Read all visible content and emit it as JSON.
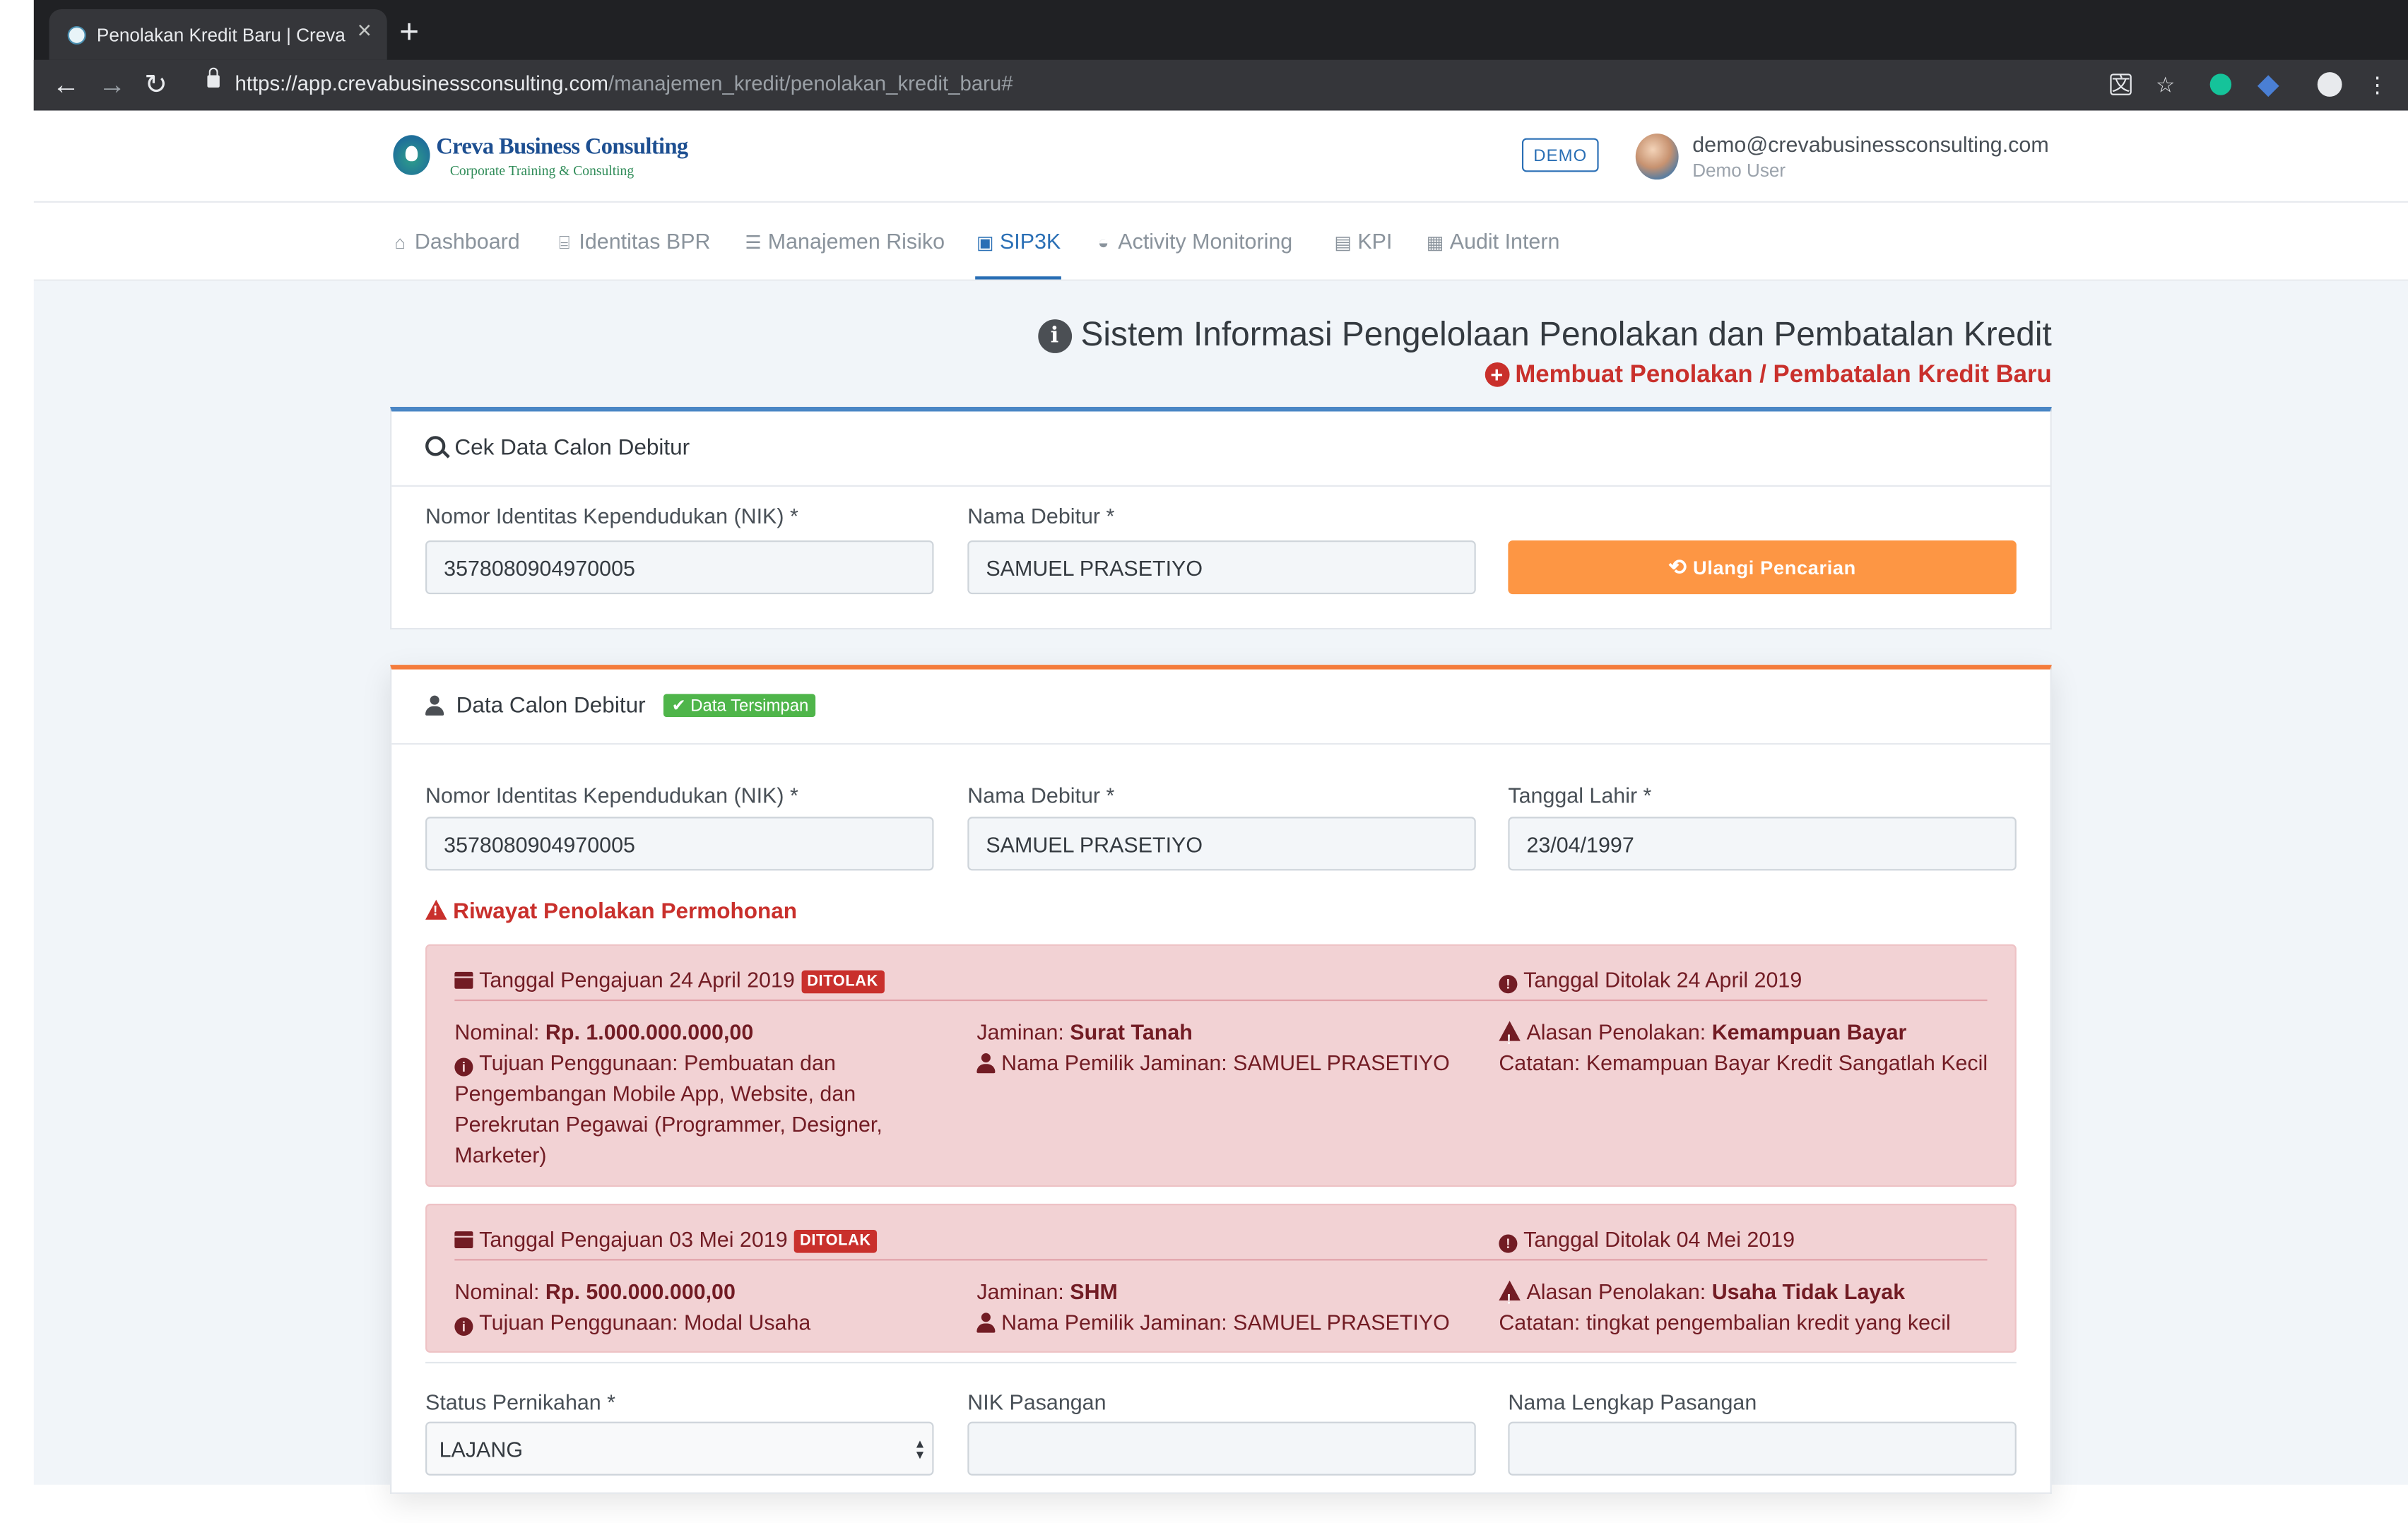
{
  "browser": {
    "tab_title": "Penolakan Kredit Baru | Creva B",
    "tab_close": "×",
    "new_tab": "+",
    "url_host": "https://app.crevabusinessconsulting.com",
    "url_path": "/manajemen_kredit/penolakan_kredit_baru#"
  },
  "header": {
    "logo_name": "Creva Business Consulting",
    "logo_tagline": "Corporate Training & Consulting",
    "demo_badge": "DEMO",
    "user_email": "demo@crevabusinessconsulting.com",
    "user_role": "Demo User"
  },
  "menu": {
    "items": [
      {
        "label": "Dashboard",
        "icon": "home-icon"
      },
      {
        "label": "Identitas BPR",
        "icon": "bank-icon"
      },
      {
        "label": "Manajemen Risiko",
        "icon": "list-icon"
      },
      {
        "label": "SIP3K",
        "icon": "contact-card-icon",
        "active": true
      },
      {
        "label": "Activity Monitoring",
        "icon": "gauge-icon"
      },
      {
        "label": "KPI",
        "icon": "clipboard-icon"
      },
      {
        "label": "Audit Intern",
        "icon": "calendar-check-icon"
      }
    ]
  },
  "page": {
    "title": "Sistem Informasi Pengelolaan Penolakan dan Pembatalan Kredit",
    "subtitle": "Membuat Penolakan / Pembatalan Kredit Baru"
  },
  "check_card": {
    "header": "Cek Data Calon Debitur",
    "nik_label": "Nomor Identitas Kependudukan (NIK) *",
    "nik_value": "3578080904970005",
    "name_label": "Nama Debitur *",
    "name_value": "SAMUEL PRASETIYO",
    "button_label": "Ulangi Pencarian"
  },
  "debtor_card": {
    "header": "Data Calon Debitur",
    "saved_badge": "Data Tersimpan",
    "nik_label": "Nomor Identitas Kependudukan (NIK) *",
    "nik_value": "3578080904970005",
    "name_label": "Nama Debitur *",
    "name_value": "SAMUEL PRASETIYO",
    "dob_label": "Tanggal Lahir *",
    "dob_value": "23/04/1997",
    "history_title": "Riwayat Penolakan Permohonan",
    "history": [
      {
        "submitted": "Tanggal Pengajuan 24 April 2019",
        "status": "DITOLAK",
        "rejected": "Tanggal Ditolak 24 April 2019",
        "nominal_label": "Nominal:",
        "nominal_value": "Rp. 1.000.000.000,00",
        "purpose": "Tujuan Penggunaan: Pembuatan dan Pengembangan Mobile App, Website, dan Perekrutan Pegawai (Programmer, Designer, Marketer)",
        "collateral_label": "Jaminan:",
        "collateral_value": "Surat Tanah",
        "owner": "Nama Pemilik Jaminan: SAMUEL PRASETIYO",
        "reason_label": "Alasan Penolakan:",
        "reason_value": "Kemampuan Bayar",
        "note": "Catatan: Kemampuan Bayar Kredit Sangatlah Kecil"
      },
      {
        "submitted": "Tanggal Pengajuan 03 Mei 2019",
        "status": "DITOLAK",
        "rejected": "Tanggal Ditolak 04 Mei 2019",
        "nominal_label": "Nominal:",
        "nominal_value": "Rp. 500.000.000,00",
        "purpose": "Tujuan Penggunaan: Modal Usaha",
        "collateral_label": "Jaminan:",
        "collateral_value": "SHM",
        "owner": "Nama Pemilik Jaminan: SAMUEL PRASETIYO",
        "reason_label": "Alasan Penolakan:",
        "reason_value": "Usaha Tidak Layak",
        "note": "Catatan: tingkat pengembalian kredit yang kecil"
      }
    ],
    "marital_label": "Status Pernikahan *",
    "marital_value": "LAJANG",
    "spouse_nik_label": "NIK Pasangan",
    "spouse_nik_value": "",
    "spouse_name_label": "Nama Lengkap Pasangan",
    "spouse_name_value": ""
  },
  "colors": {
    "primary": "#2a6fb5",
    "orange": "#fd9644",
    "danger": "#c9302c",
    "alert_bg": "#f2d2d4",
    "success": "#4fb54a"
  }
}
